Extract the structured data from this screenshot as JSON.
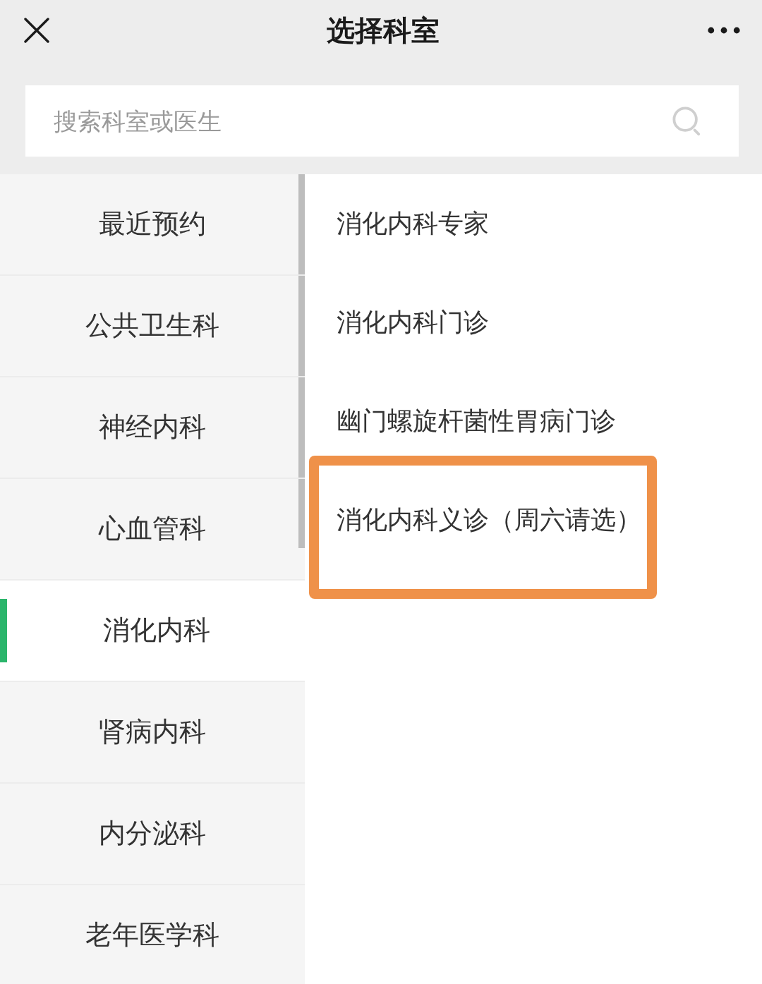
{
  "window": {
    "title": "选择科室"
  },
  "search": {
    "placeholder": "搜索科室或医生"
  },
  "sidebar": {
    "items": [
      {
        "label": "最近预约",
        "selected": false
      },
      {
        "label": "公共卫生科",
        "selected": false
      },
      {
        "label": "神经内科",
        "selected": false
      },
      {
        "label": "心血管科",
        "selected": false
      },
      {
        "label": "消化内科",
        "selected": true
      },
      {
        "label": "肾病内科",
        "selected": false
      },
      {
        "label": "内分泌科",
        "selected": false
      },
      {
        "label": "老年医学科",
        "selected": false
      }
    ]
  },
  "departments": [
    {
      "label": "消化内科专家",
      "highlighted": false
    },
    {
      "label": "消化内科门诊",
      "highlighted": false
    },
    {
      "label": "幽门螺旋杆菌性胃病门诊",
      "highlighted": false
    },
    {
      "label": "消化内科义诊（周六请选）",
      "highlighted": true
    }
  ]
}
